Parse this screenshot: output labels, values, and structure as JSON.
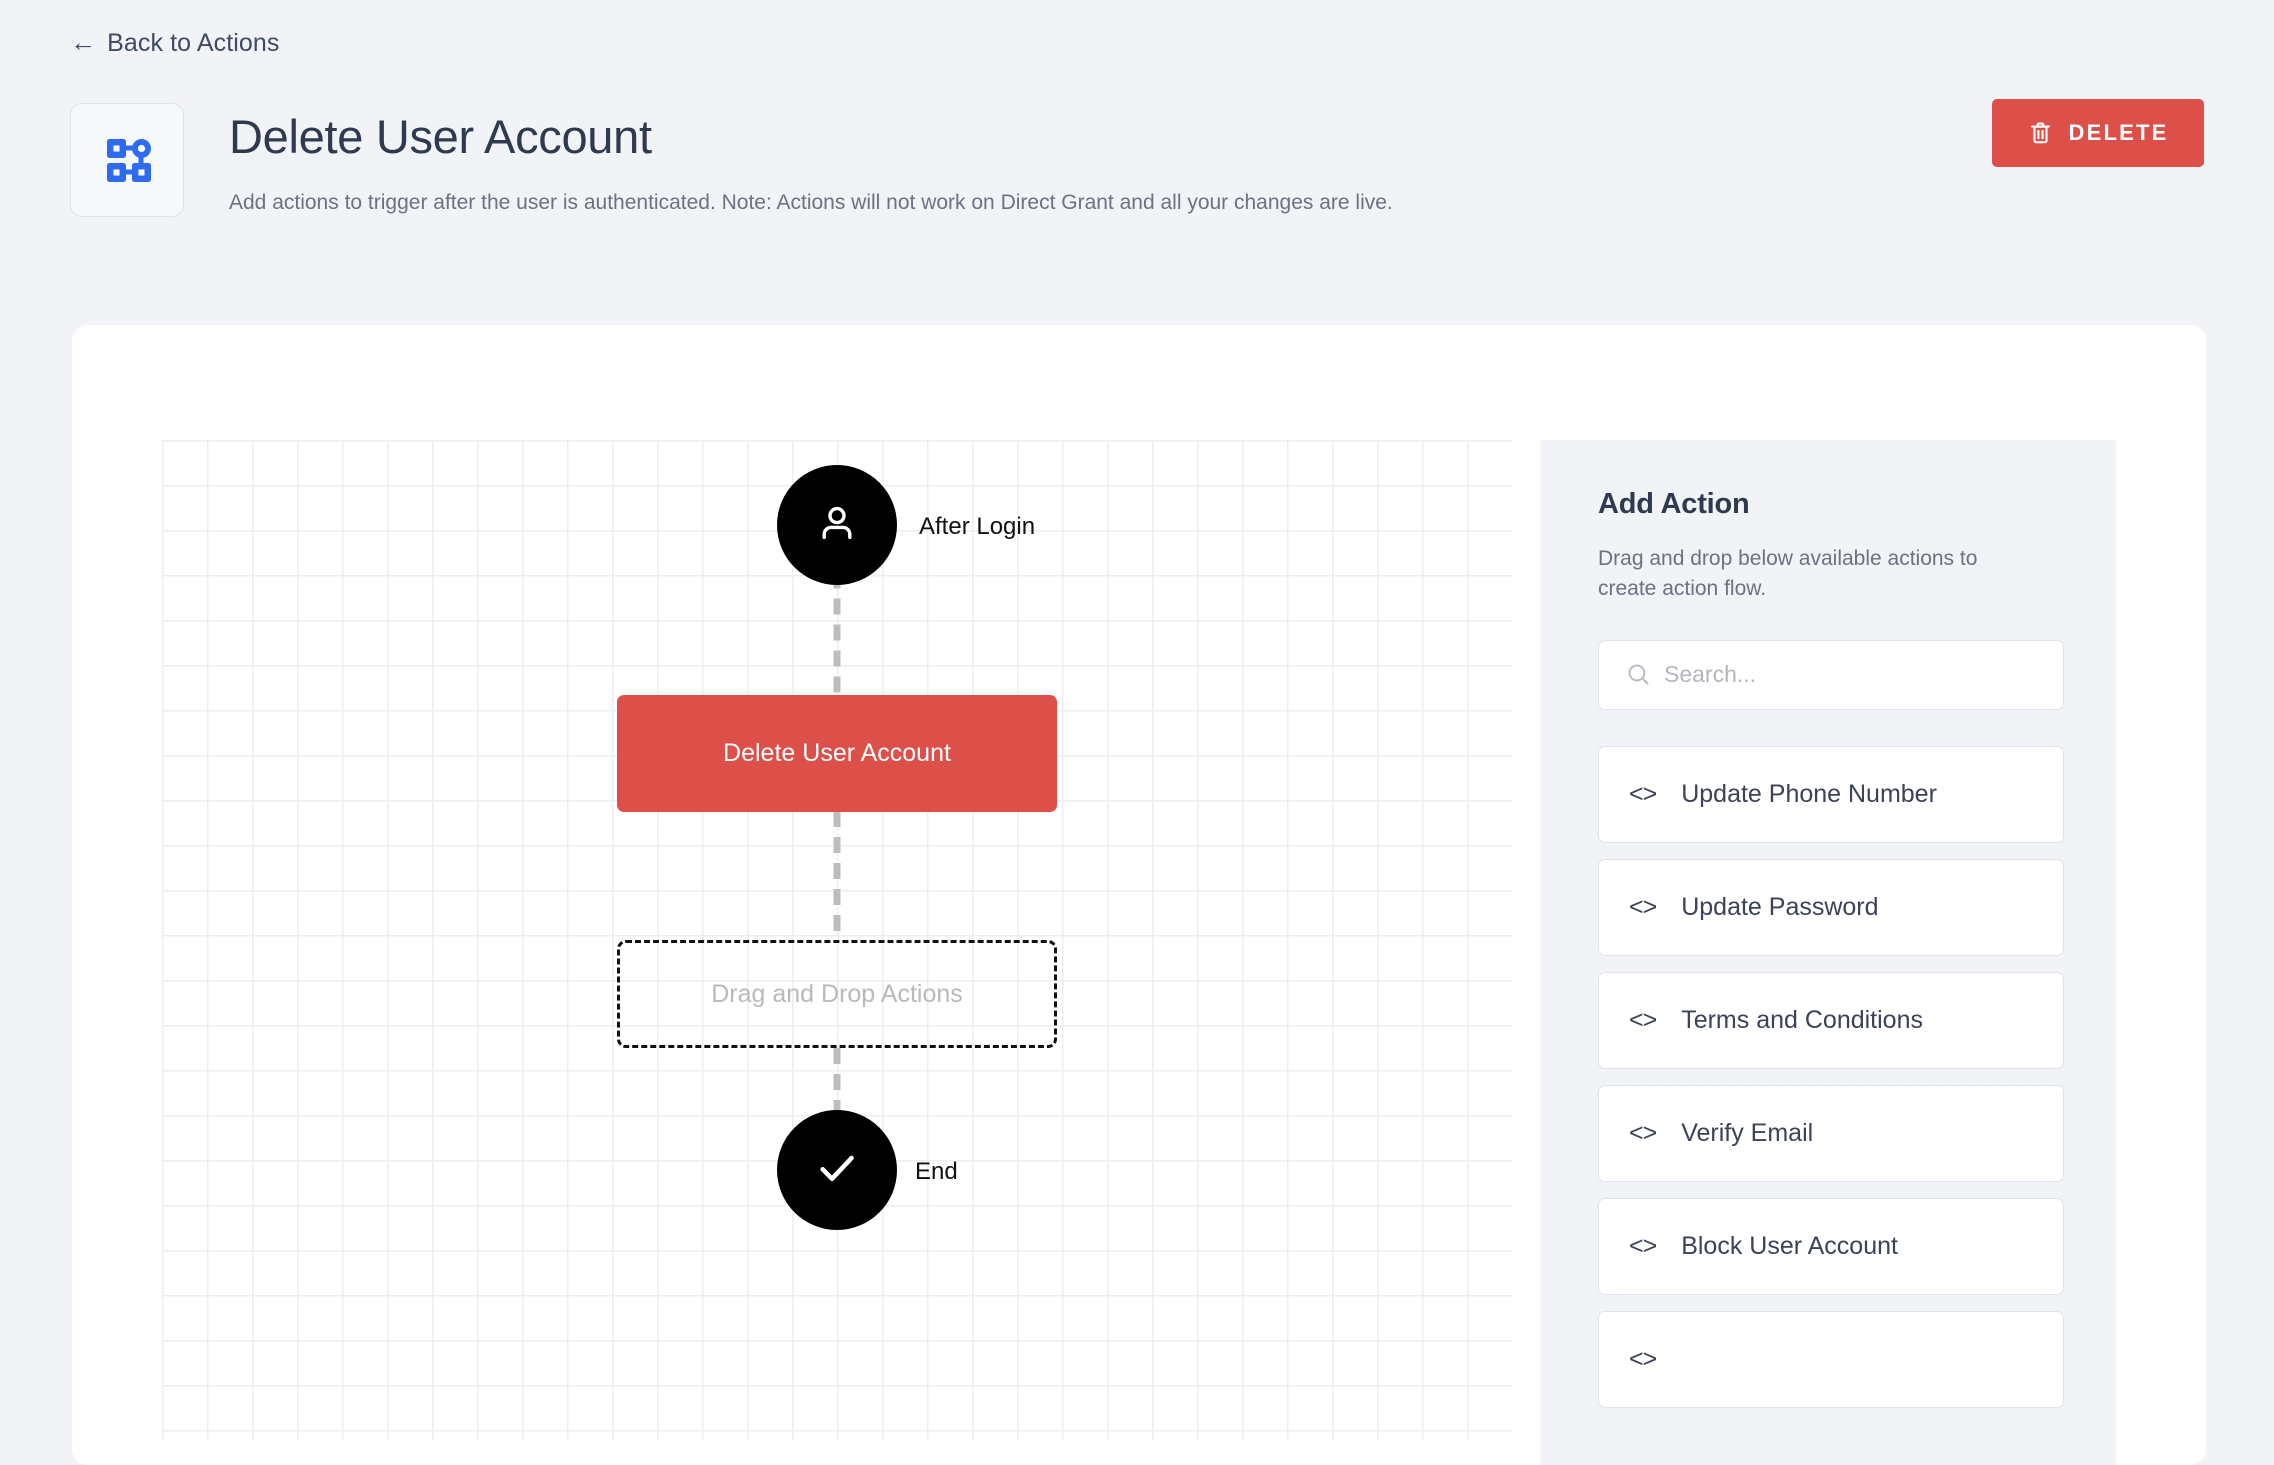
{
  "header": {
    "back_link": "Back to Actions",
    "back_arrow_icon": "arrow-left-icon",
    "app_icon": "flow-diagram-icon",
    "title": "Delete User Account",
    "subtitle": "Add actions to trigger after the user is authenticated. Note: Actions will not work on Direct Grant and all your changes are live.",
    "delete_label": "DELETE",
    "delete_icon": "trash-icon",
    "delete_color": "#dd4f49"
  },
  "flow": {
    "start_node": {
      "label": "After Login",
      "icon": "user-icon",
      "color": "#000000"
    },
    "action_node": {
      "label": "Delete User Account",
      "color": "#dd4f49"
    },
    "dropzone": {
      "label": "Drag and Drop Actions"
    },
    "end_node": {
      "label": "End",
      "icon": "check-icon",
      "color": "#000000"
    }
  },
  "panel": {
    "title": "Add Action",
    "description": "Drag and drop below available actions to create action flow.",
    "search": {
      "placeholder": "Search...",
      "value": "",
      "icon": "search-icon"
    },
    "actions": [
      {
        "label": "Update Phone Number",
        "icon": "code-icon"
      },
      {
        "label": "Update Password",
        "icon": "code-icon"
      },
      {
        "label": "Terms and Conditions",
        "icon": "code-icon"
      },
      {
        "label": "Verify Email",
        "icon": "code-icon"
      },
      {
        "label": "Block User Account",
        "icon": "code-icon"
      },
      {
        "label": "",
        "icon": "code-icon"
      }
    ]
  }
}
